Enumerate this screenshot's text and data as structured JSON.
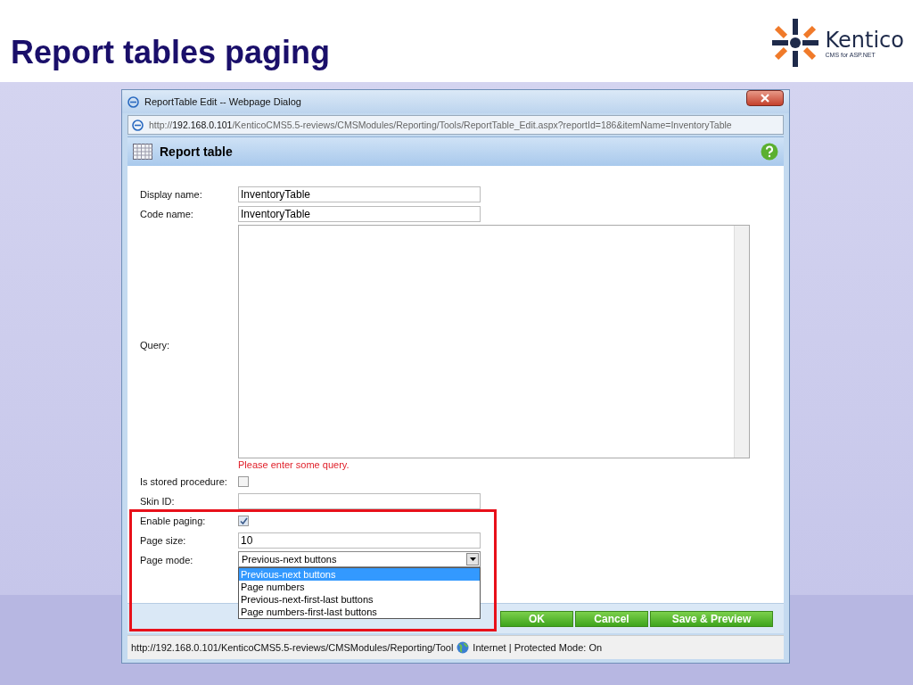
{
  "slide": {
    "title": "Report tables paging",
    "logo": {
      "name": "Kentico",
      "tagline": "CMS for ASP.NET"
    }
  },
  "dialog": {
    "title": "ReportTable Edit -- Webpage Dialog",
    "address": "http://**192.168.0.101**/KenticoCMS5.5-reviews/CMSModules/Reporting/Tools/ReportTable_Edit.aspx?reportId=186&itemName=InventoryTable",
    "header": {
      "title": "Report table"
    },
    "fields": [
      {
        "kind": "text",
        "label": "Display name:",
        "value": "InventoryTable"
      },
      {
        "kind": "text",
        "label": "Code name:",
        "value": "InventoryTable"
      },
      {
        "kind": "textarea",
        "label": "Query:",
        "error": "Please enter some query."
      },
      {
        "kind": "checkbox",
        "label": "Is stored procedure:",
        "checked": false
      },
      {
        "kind": "text",
        "label": "Skin ID:"
      },
      {
        "kind": "checkbox",
        "label": "Enable paging:",
        "checked": true
      },
      {
        "kind": "text",
        "label": "Page size:",
        "value": "10"
      },
      {
        "kind": "select",
        "label": "Page mode:",
        "value": "Previous-next buttons",
        "expanded": true,
        "options": [
          {
            "label": "Previous-next buttons",
            "selected": true
          },
          {
            "label": "Page numbers",
            "selected": false
          },
          {
            "label": "Previous-next-first-last buttons",
            "selected": false
          },
          {
            "label": "Page numbers-first-last buttons",
            "selected": false
          }
        ]
      }
    ],
    "buttons": [
      "OK",
      "Cancel",
      "Save & Preview"
    ],
    "status_bar": {
      "url": "http://192.168.0.101/KenticoCMS5.5-reviews/CMSModules/Reporting/Tool",
      "zone": "Internet | Protected Mode: On"
    }
  }
}
